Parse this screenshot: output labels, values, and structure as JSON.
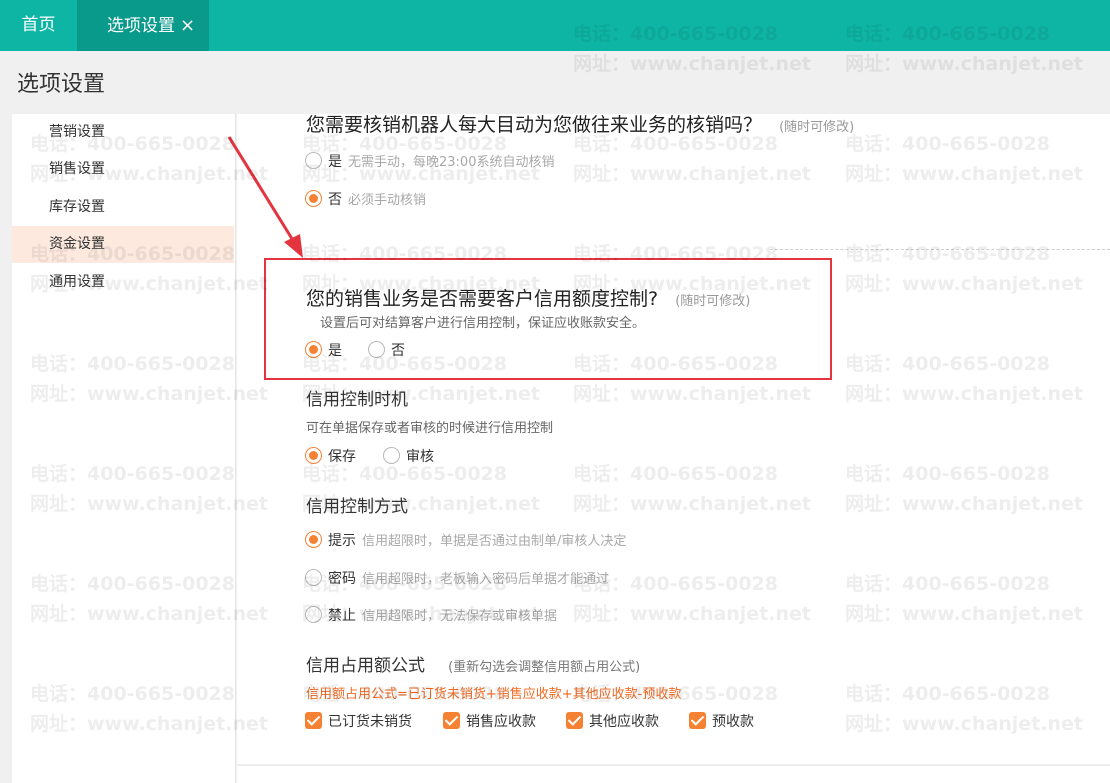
{
  "tabs": {
    "home": "首页",
    "active": "选项设置",
    "close": "×"
  },
  "page_title": "选项设置",
  "sidebar": {
    "items": [
      {
        "label": "营销设置",
        "active": false
      },
      {
        "label": "销售设置",
        "active": false
      },
      {
        "label": "库存设置",
        "active": false
      },
      {
        "label": "资金设置",
        "active": true
      },
      {
        "label": "通用设置",
        "active": false
      }
    ]
  },
  "auto_writeoff": {
    "question": "您需要核销机器人每大目动为您做往来业务的核销吗？",
    "hint": "(随时可修改)",
    "options": [
      {
        "label": "是",
        "desc": "无需手动，每晚23:00系统自动核销",
        "selected": false
      },
      {
        "label": "否",
        "desc": "必须手动核销",
        "selected": true
      }
    ]
  },
  "credit_control": {
    "question": "您的销售业务是否需要客户信用额度控制?",
    "hint": "(随时可修改)",
    "description": "设置后可对结算客户进行信用控制，保证应收账款安全。",
    "options": [
      {
        "label": "是",
        "selected": true
      },
      {
        "label": "否",
        "selected": false
      }
    ]
  },
  "credit_timing": {
    "title": "信用控制时机",
    "description": "可在单据保存或者审核的时候进行信用控制",
    "options": [
      {
        "label": "保存",
        "selected": true
      },
      {
        "label": "审核",
        "selected": false
      }
    ]
  },
  "credit_method": {
    "title": "信用控制方式",
    "options": [
      {
        "label": "提示",
        "desc": "信用超限时，单据是否通过由制单/审核人决定",
        "selected": true
      },
      {
        "label": "密码",
        "desc": "信用超限时，老板输入密码后单据才能通过",
        "selected": false
      },
      {
        "label": "禁止",
        "desc": "信用超限时，无法保存或审核单据",
        "selected": false
      }
    ]
  },
  "credit_formula": {
    "title": "信用占用额公式",
    "hint": "(重新勾选会调整信用额占用公式)",
    "formula": "信用额占用公式=已订货未销货+销售应收款+其他应收款-预收款",
    "checkboxes": [
      {
        "label": "已订货未销货",
        "checked": true
      },
      {
        "label": "销售应收款",
        "checked": true
      },
      {
        "label": "其他应收款",
        "checked": true
      },
      {
        "label": "预收款",
        "checked": true
      }
    ]
  },
  "watermark": {
    "phone": "电话：400-665-0028",
    "site": "网址：www.chanjet.net"
  },
  "colors": {
    "topbar": "#0eb5a4",
    "accent": "#f58233",
    "highlight": "#e3343f",
    "formula": "#f26a21"
  }
}
